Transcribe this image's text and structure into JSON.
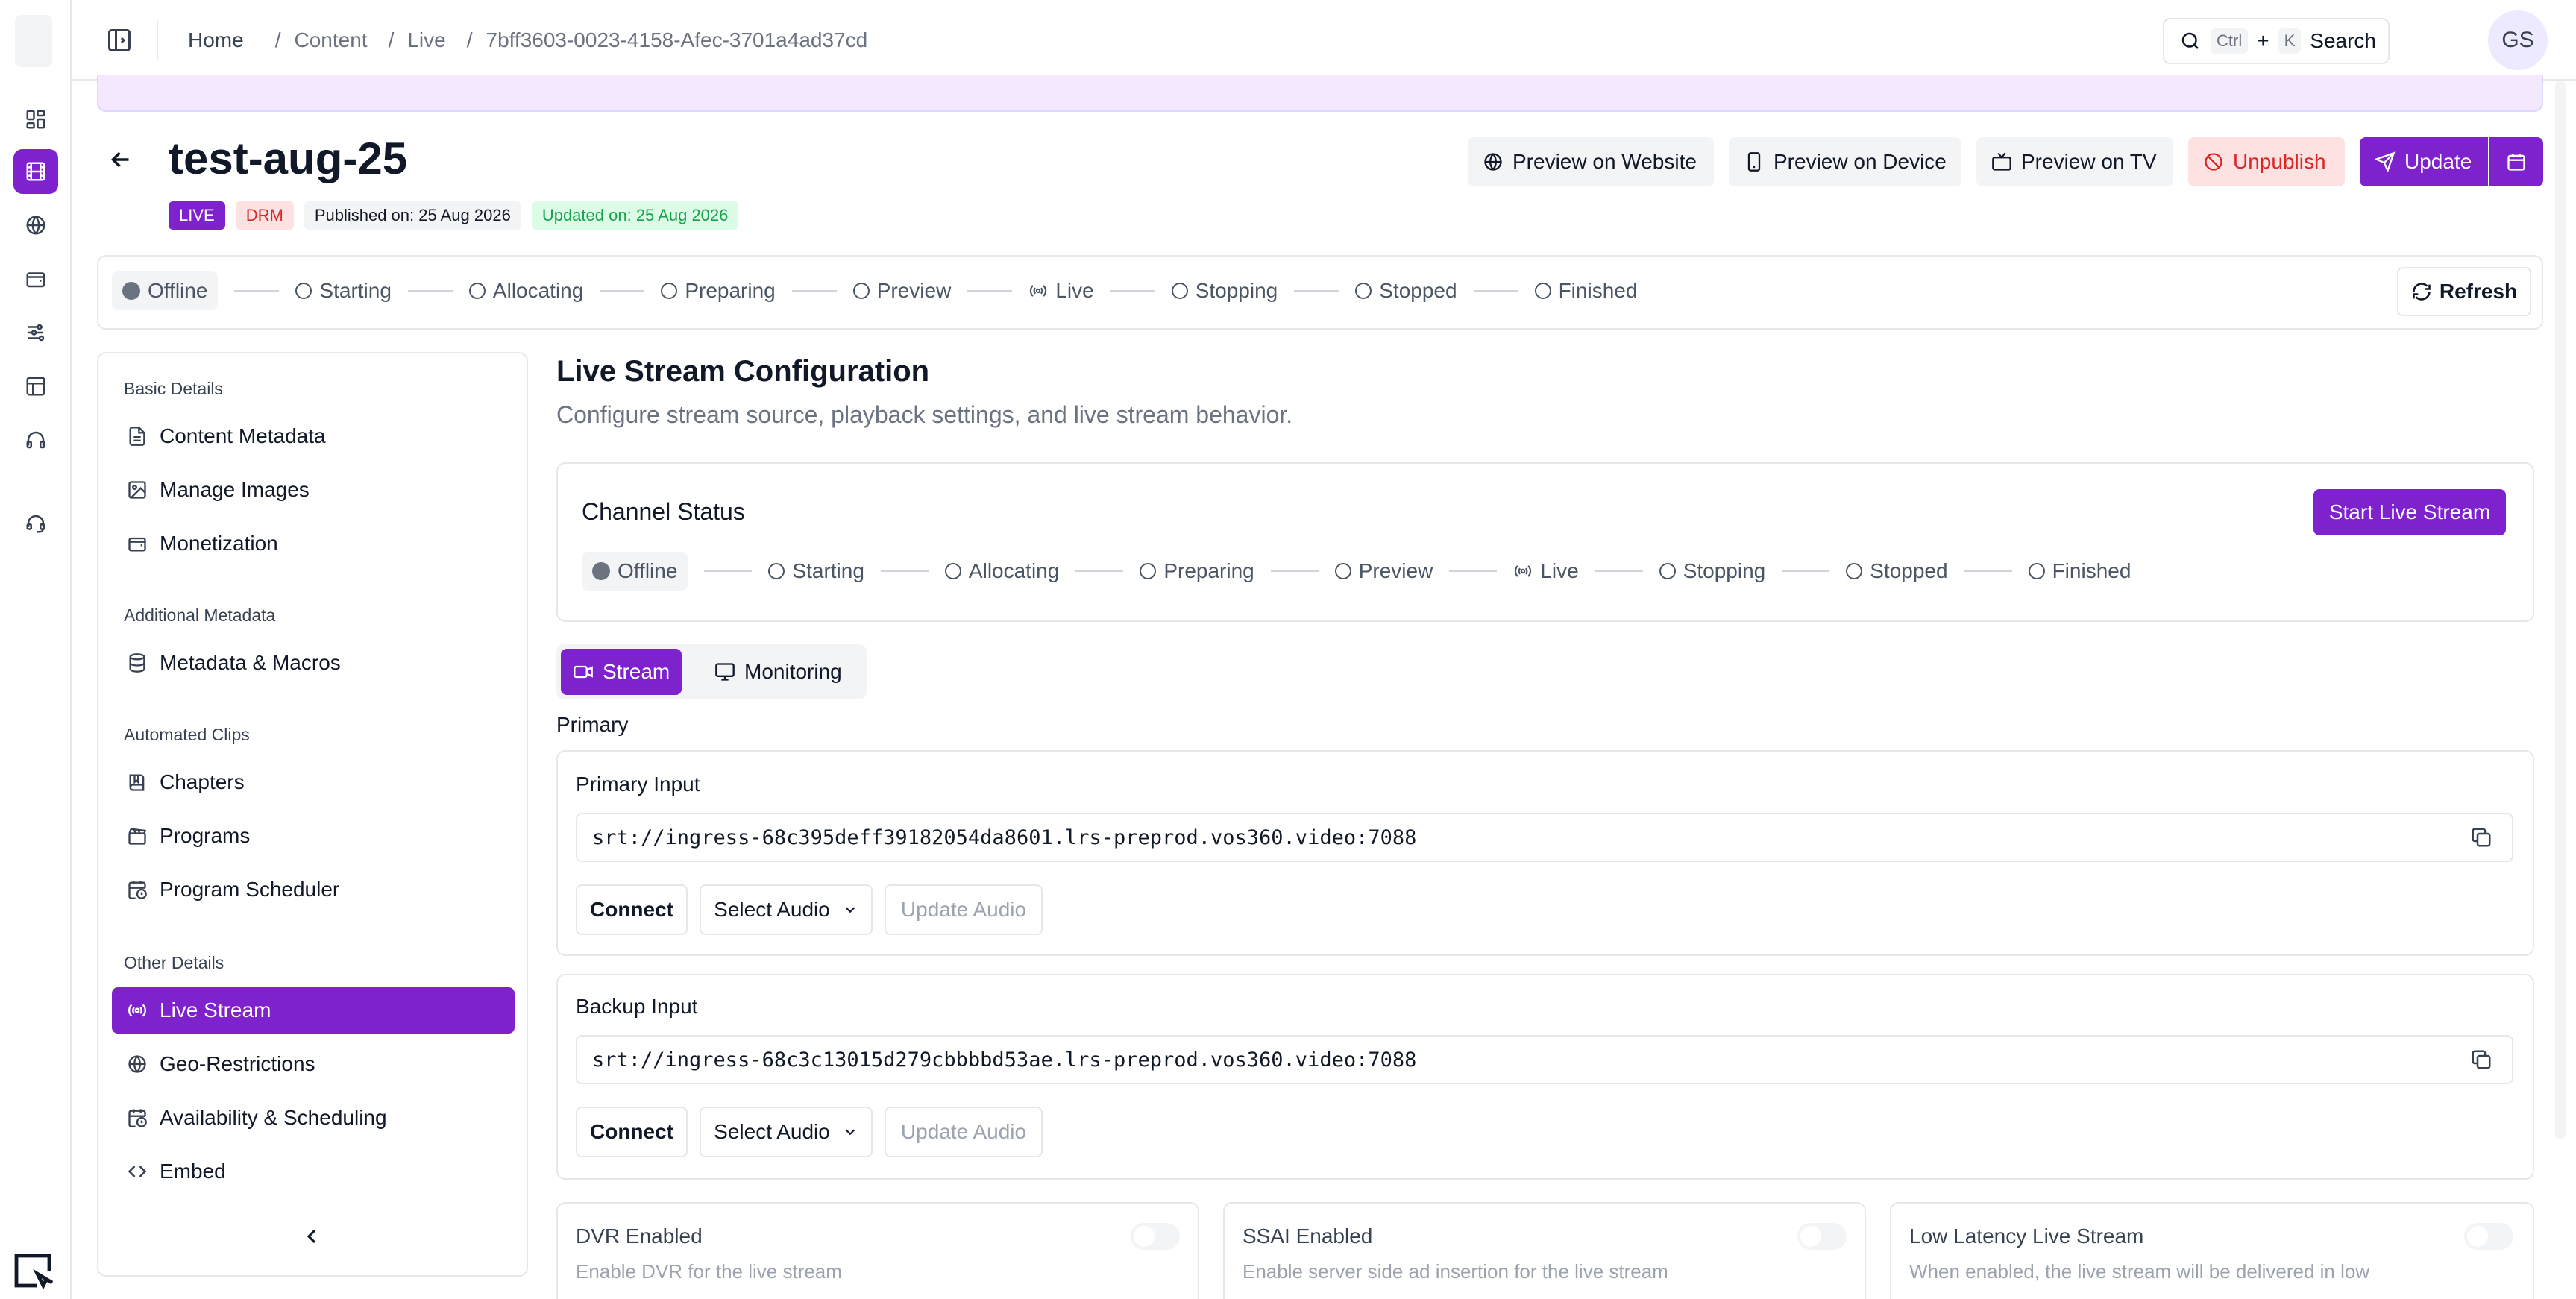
{
  "header": {
    "breadcrumbs": [
      "Home",
      "Content",
      "Live",
      "7bff3603-0023-4158-Afec-3701a4ad37cd"
    ],
    "search": {
      "kbd1": "Ctrl",
      "plus": "+",
      "kbd2": "K",
      "label": "Search"
    },
    "avatar": "GS"
  },
  "page": {
    "title": "test-aug-25",
    "badges": {
      "live": "LIVE",
      "drm": "DRM",
      "published": "Published on: 25 Aug 2026",
      "updated": "Updated on: 25 Aug 2026"
    },
    "actions": {
      "preview_website": "Preview on Website",
      "preview_device": "Preview on Device",
      "preview_tv": "Preview on TV",
      "unpublish": "Unpublish",
      "update": "Update"
    }
  },
  "status_steps": [
    "Offline",
    "Starting",
    "Allocating",
    "Preparing",
    "Preview",
    "Live",
    "Stopping",
    "Stopped",
    "Finished"
  ],
  "current_step": "Offline",
  "refresh_label": "Refresh",
  "sidebar": {
    "sections": [
      {
        "title": "Basic Details",
        "items": [
          "Content Metadata",
          "Manage Images",
          "Monetization"
        ]
      },
      {
        "title": "Additional Metadata",
        "items": [
          "Metadata & Macros"
        ]
      },
      {
        "title": "Automated Clips",
        "items": [
          "Chapters",
          "Programs",
          "Program Scheduler"
        ]
      },
      {
        "title": "Other Details",
        "items": [
          "Live Stream",
          "Geo-Restrictions",
          "Availability & Scheduling",
          "Embed"
        ]
      }
    ],
    "active_item": "Live Stream"
  },
  "main": {
    "title": "Live Stream Configuration",
    "subtitle": "Configure stream source, playback settings, and live stream behavior.",
    "channel_status": {
      "title": "Channel Status",
      "start_button": "Start Live Stream"
    },
    "tabs": [
      "Stream",
      "Monitoring"
    ],
    "active_tab": "Stream",
    "primary_label": "Primary",
    "primary_input": {
      "title": "Primary Input",
      "url": "srt://ingress-68c395deff39182054da8601.lrs-preprod.vos360.video:7088",
      "connect": "Connect",
      "select_audio": "Select Audio",
      "update_audio": "Update Audio"
    },
    "backup_input": {
      "title": "Backup Input",
      "url": "srt://ingress-68c3c13015d279cbbbbd53ae.lrs-preprod.vos360.video:7088",
      "connect": "Connect",
      "select_audio": "Select Audio",
      "update_audio": "Update Audio"
    },
    "features": [
      {
        "title": "DVR Enabled",
        "desc": "Enable DVR for the live stream",
        "enabled": false
      },
      {
        "title": "SSAI Enabled",
        "desc": "Enable server side ad insertion for the live stream",
        "enabled": false
      },
      {
        "title": "Low Latency Live Stream",
        "desc": "When enabled, the live stream will be delivered in low",
        "enabled": false
      }
    ]
  },
  "colors": {
    "accent": "#7e22ce",
    "danger": "#dc2626",
    "success": "#16a34a"
  }
}
